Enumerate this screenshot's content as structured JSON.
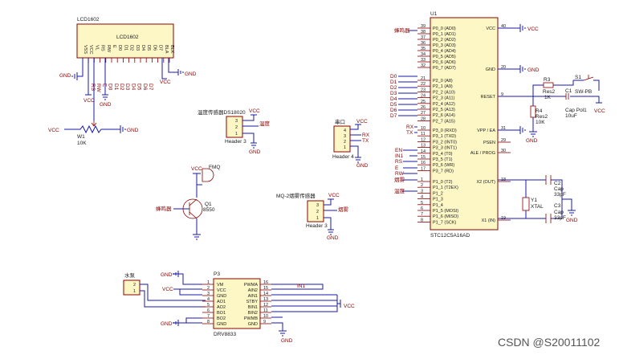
{
  "lcd": {
    "ref": "LCD1602",
    "name": "LCD1602",
    "pins": [
      "VSS",
      "VCC",
      "VL",
      "RS",
      "RW",
      "E",
      "D0",
      "D1",
      "D2",
      "D3",
      "D4",
      "D5",
      "D6",
      "D7",
      "BLA",
      "BLK"
    ],
    "nets_top": [
      "RS",
      "RW",
      "E",
      "D0",
      "D1",
      "D2",
      "D3",
      "D4",
      "D5",
      "D6",
      "D7"
    ]
  },
  "pot": {
    "ref": "W1",
    "value": "10K"
  },
  "power": {
    "vcc": "VCC",
    "gnd": "GND",
    "vcc_upper": "VCC"
  },
  "temp": {
    "title": "温度传感器DS18020",
    "header": "Header 3",
    "net": "温度",
    "pins": [
      "3",
      "2",
      "1"
    ]
  },
  "serial": {
    "title": "串口",
    "header": "Header 4",
    "pins": [
      "4",
      "3",
      "2",
      "1"
    ],
    "rx": "RX",
    "tx": "TX"
  },
  "buzzer": {
    "ref": "FMQ",
    "q_ref": "Q1",
    "q_val": "8550",
    "net": "蜂鸣器"
  },
  "smoke": {
    "title": "MQ-2烟雾传感器",
    "header": "Header 3",
    "net": "烟雾",
    "pins": [
      "3",
      "2",
      "1"
    ]
  },
  "mcu": {
    "ref": "U1",
    "part": "STC12C5A16AD",
    "left_pins": [
      {
        "n": "39",
        "name": "P0_0 (AD0)"
      },
      {
        "n": "38",
        "name": "P0_1 (AD1)"
      },
      {
        "n": "37",
        "name": "P0_2 (AD2)"
      },
      {
        "n": "36",
        "name": "P0_3 (AD3)"
      },
      {
        "n": "35",
        "name": "P0_4 (AD4)"
      },
      {
        "n": "34",
        "name": "P0_5 (AD5)"
      },
      {
        "n": "33",
        "name": "P0_6 (AD6)"
      },
      {
        "n": "32",
        "name": "P0_7 (AD7)"
      },
      {
        "n": "21",
        "name": "P2_0 (A8)"
      },
      {
        "n": "22",
        "name": "P2_1 (A9)"
      },
      {
        "n": "23",
        "name": "P2_2 (A10)"
      },
      {
        "n": "24",
        "name": "P2_3 (A11)"
      },
      {
        "n": "25",
        "name": "P2_4 (A12)"
      },
      {
        "n": "26",
        "name": "P2_5 (A13)"
      },
      {
        "n": "27",
        "name": "P2_6 (A14)"
      },
      {
        "n": "28",
        "name": "P2_7 (A15)"
      },
      {
        "n": "10",
        "name": "P3_0 (RXD)"
      },
      {
        "n": "11",
        "name": "P3_1 (TXD)"
      },
      {
        "n": "12",
        "name": "P3_2 (INT0)"
      },
      {
        "n": "13",
        "name": "P3_3 (INT1)"
      },
      {
        "n": "14",
        "name": "P3_4 (T0)"
      },
      {
        "n": "15",
        "name": "P3_5 (T1)"
      },
      {
        "n": "16",
        "name": "P3_6 (WR)"
      },
      {
        "n": "17",
        "name": "P3_7 (RD)"
      },
      {
        "n": "1",
        "name": "P1_0 (T2)"
      },
      {
        "n": "2",
        "name": "P1_1 (T2EX)"
      },
      {
        "n": "3",
        "name": "P1_2"
      },
      {
        "n": "4",
        "name": "P1_3"
      },
      {
        "n": "5",
        "name": "P1_4"
      },
      {
        "n": "6",
        "name": "P1_5 (MOSI)"
      },
      {
        "n": "7",
        "name": "P1_6 (MISO)"
      },
      {
        "n": "8",
        "name": "P1_7 (SCK)"
      }
    ],
    "right_pins": [
      {
        "n": "40",
        "name": "VCC"
      },
      {
        "n": "20",
        "name": "GND"
      },
      {
        "n": "9",
        "name": "RESET"
      },
      {
        "n": "31",
        "name": "VPP / EA"
      },
      {
        "n": "29",
        "name": "PSEN"
      },
      {
        "n": "30",
        "name": "ALE / PROG"
      },
      {
        "n": "18",
        "name": "X2 (OUT)"
      },
      {
        "n": "19",
        "name": "X1 (IN)"
      }
    ],
    "left_nets": [
      "蜂鸣器",
      "D0",
      "D1",
      "D2",
      "D3",
      "D4",
      "D5",
      "D6",
      "D7",
      "RX",
      "TX",
      "EN",
      "IN1",
      "RS",
      "E",
      "RW",
      "烟雾",
      "温度"
    ]
  },
  "reset": {
    "r3": "R3",
    "r3v": "1K",
    "r3n": "Res2",
    "s1": "S1",
    "s1v": "SW-PB",
    "c1": "C1",
    "c1v": "10uF",
    "c1n": "Cap Pol1",
    "r4": "R4",
    "r4n": "Res2",
    "r4v": "10K"
  },
  "crystal": {
    "y1": "Y1",
    "y1v": "XTAL",
    "c2": "C2",
    "c2n": "Cap",
    "c2v": "33pF",
    "c3": "C3",
    "c3n": "Cap",
    "c3v": "33pF"
  },
  "pump": {
    "title": "水泵",
    "pins": [
      "2",
      "1"
    ]
  },
  "driver": {
    "ref": "P3",
    "part": "DRV8833",
    "left": [
      {
        "n": "1",
        "name": "VM"
      },
      {
        "n": "2",
        "name": "VCC"
      },
      {
        "n": "3",
        "name": "GND"
      },
      {
        "n": "4",
        "name": "AO1"
      },
      {
        "n": "5",
        "name": "AO2"
      },
      {
        "n": "6",
        "name": "BO1"
      },
      {
        "n": "7",
        "name": "BO2"
      },
      {
        "n": "8",
        "name": "GND"
      }
    ],
    "right": [
      {
        "n": "16",
        "name": "PWMA"
      },
      {
        "n": "15",
        "name": "AIN2"
      },
      {
        "n": "14",
        "name": "AIN1"
      },
      {
        "n": "13",
        "name": "STBY"
      },
      {
        "n": "12",
        "name": "BIN1"
      },
      {
        "n": "11",
        "name": "BIN2"
      },
      {
        "n": "10",
        "name": "PWMB"
      },
      {
        "n": "9",
        "name": "GND"
      }
    ],
    "in1": "IN1"
  },
  "watermark": "CSDN @S20011102"
}
